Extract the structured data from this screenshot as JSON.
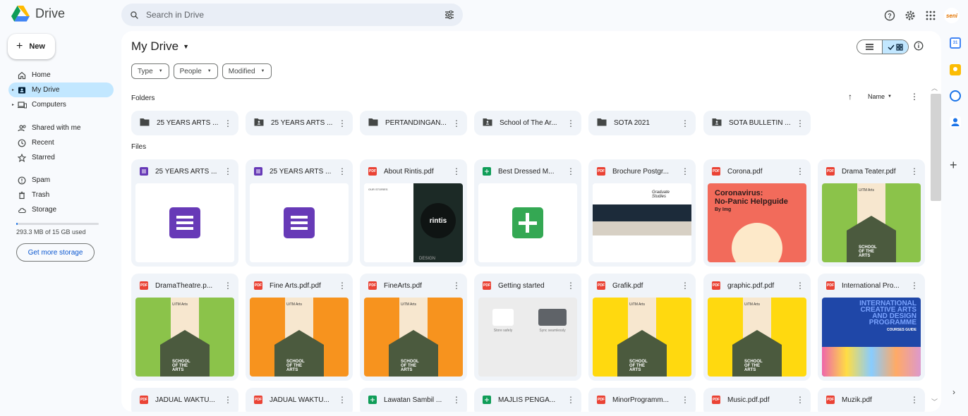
{
  "app": {
    "title": "Drive"
  },
  "search": {
    "placeholder": "Search in Drive"
  },
  "avatar_text": "seni",
  "new_button": "New",
  "nav": {
    "home": "Home",
    "my_drive": "My Drive",
    "computers": "Computers",
    "shared": "Shared with me",
    "recent": "Recent",
    "starred": "Starred",
    "spam": "Spam",
    "trash": "Trash",
    "storage": "Storage"
  },
  "storage": {
    "used_text": "293.3 MB of 15 GB used",
    "used_fraction": 0.02,
    "button": "Get more storage"
  },
  "main": {
    "title": "My Drive",
    "filters": [
      "Type",
      "People",
      "Modified"
    ],
    "folders_label": "Folders",
    "files_label": "Files",
    "sort_label": "Name"
  },
  "folders": [
    {
      "name": "25 YEARS ARTS ...",
      "shared": false
    },
    {
      "name": "25 YEARS ARTS ...",
      "shared": true
    },
    {
      "name": "PERTANDINGAN...",
      "shared": false
    },
    {
      "name": "School of The Ar...",
      "shared": true
    },
    {
      "name": "SOTA 2021",
      "shared": false
    },
    {
      "name": "SOTA BULLETIN ...",
      "shared": true
    }
  ],
  "files": [
    {
      "name": "25 YEARS ARTS ...",
      "type": "form",
      "thumb": "form"
    },
    {
      "name": "25 YEARS ARTS ...",
      "type": "form",
      "thumb": "form"
    },
    {
      "name": "About Rintis.pdf",
      "type": "pdf",
      "thumb": "rintis"
    },
    {
      "name": "Best Dressed M...",
      "type": "sheet",
      "thumb": "sheet"
    },
    {
      "name": "Brochure Postgr...",
      "type": "pdf",
      "thumb": "brochure"
    },
    {
      "name": "Corona.pdf",
      "type": "pdf",
      "thumb": "corona"
    },
    {
      "name": "Drama Teater.pdf",
      "type": "pdf",
      "thumb": "green"
    },
    {
      "name": "DramaTheatre.p...",
      "type": "pdf",
      "thumb": "green"
    },
    {
      "name": "Fine Arts.pdf.pdf",
      "type": "pdf",
      "thumb": "orange"
    },
    {
      "name": "FineArts.pdf",
      "type": "pdf",
      "thumb": "orange"
    },
    {
      "name": "Getting started",
      "type": "pdf",
      "thumb": "gs"
    },
    {
      "name": "Grafik.pdf",
      "type": "pdf",
      "thumb": "yellow"
    },
    {
      "name": "graphic.pdf.pdf",
      "type": "pdf",
      "thumb": "yellow"
    },
    {
      "name": "International Pro...",
      "type": "pdf",
      "thumb": "intl"
    },
    {
      "name": "JADUAL WAKTU...",
      "type": "pdf",
      "thumb": "none"
    },
    {
      "name": "JADUAL WAKTU...",
      "type": "pdf",
      "thumb": "none"
    },
    {
      "name": "Lawatan Sambil ...",
      "type": "sheet",
      "thumb": "none"
    },
    {
      "name": "MAJLIS PENGA...",
      "type": "sheet",
      "thumb": "none"
    },
    {
      "name": "MinorProgramm...",
      "type": "pdf",
      "thumb": "none"
    },
    {
      "name": "Music.pdf.pdf",
      "type": "pdf",
      "thumb": "none"
    },
    {
      "name": "Muzik.pdf",
      "type": "pdf",
      "thumb": "none"
    }
  ],
  "thumb_text": {
    "poster_title": "SCHOOL\nOF THE\nARTS",
    "poster_logo": "UiTM Arts",
    "corona_title": "Coronavirus:\nNo-Panic Helpguide",
    "corona_by": "By Img",
    "brochure_title": "Graduate\nStudies",
    "intl_title": "INTERNATIONAL\nCREATIVE ARTS\nAND DESIGN\nPROGRAMME",
    "intl_sub": "COURSES GUIDE",
    "gs_left": "Store safely",
    "gs_right": "Sync seamlessly",
    "rintis_logo": "rintis",
    "rintis_footer": "DESIGN",
    "rintis_heading": "OUR STORIES"
  },
  "colors": {
    "accent": "#0b57d0",
    "selected": "#c2e7ff",
    "pdf": "#ea4335",
    "form": "#673ab7",
    "sheet": "#0f9d58"
  }
}
